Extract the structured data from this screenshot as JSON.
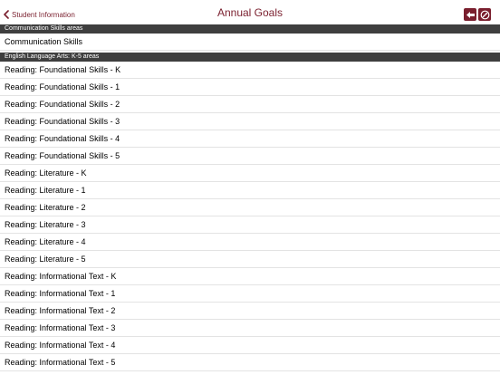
{
  "navbar": {
    "back_label": "Student Information",
    "title": "Annual Goals",
    "icons": [
      "back-arrow-icon",
      "edit-icon"
    ]
  },
  "sections": [
    {
      "header": "Communication Skills areas",
      "items": [
        "Communication Skills"
      ]
    },
    {
      "header": "English Language Arts: K-5 areas",
      "items": [
        "Reading: Foundational Skills - K",
        "Reading: Foundational Skills - 1",
        "Reading: Foundational Skills - 2",
        "Reading: Foundational Skills - 3",
        "Reading: Foundational Skills - 4",
        "Reading: Foundational Skills - 5",
        "Reading: Literature - K",
        "Reading: Literature - 1",
        "Reading: Literature - 2",
        "Reading: Literature - 3",
        "Reading: Literature - 4",
        "Reading: Literature - 5",
        "Reading: Informational Text - K",
        "Reading: Informational Text - 1",
        "Reading: Informational Text - 2",
        "Reading: Informational Text - 3",
        "Reading: Informational Text - 4",
        "Reading: Informational Text - 5"
      ]
    }
  ],
  "colors": {
    "accent": "#7a1f2e",
    "section_header_bg": "#3f3f3f",
    "separator": "#e3e3e3"
  }
}
